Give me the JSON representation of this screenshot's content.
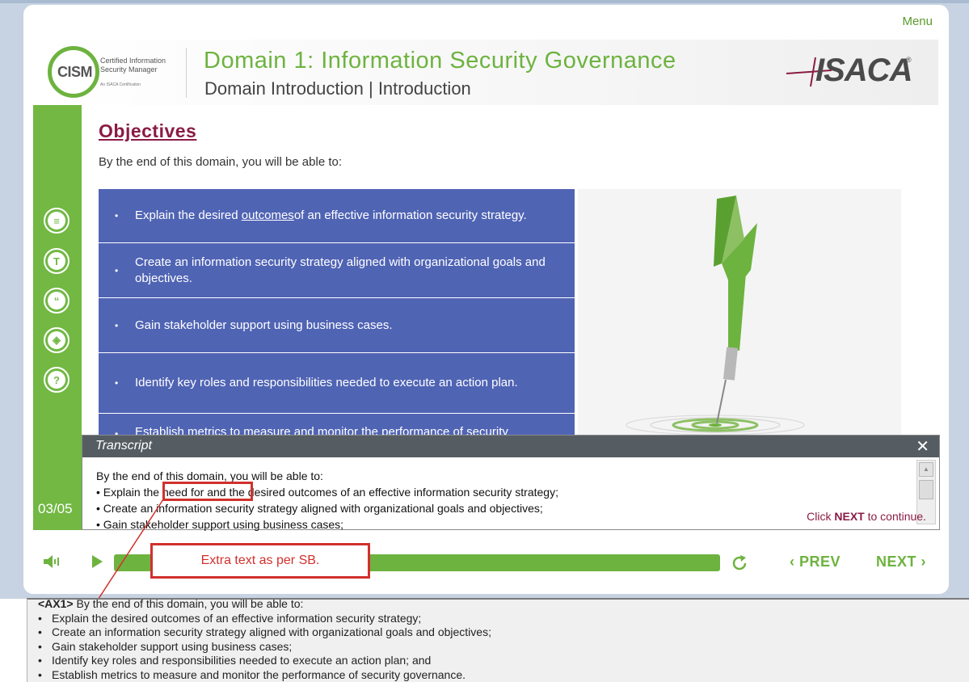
{
  "header": {
    "menu_label": "Menu",
    "cism_mark": "CISM",
    "cism_subtitle_line1": "Certified Information",
    "cism_subtitle_line2": "Security Manager",
    "cism_tagline": "An ISACA Certification",
    "domain_title": "Domain 1: Information Security Governance",
    "domain_subtitle": "Domain Introduction | Introduction",
    "isaca_logo": "ISACA",
    "isaca_reg": "®"
  },
  "sidebar": {
    "icons": [
      {
        "name": "notes-icon",
        "glyph": "≡"
      },
      {
        "name": "transcript-icon",
        "glyph": "T"
      },
      {
        "name": "quote-icon",
        "glyph": "“"
      },
      {
        "name": "layers-icon",
        "glyph": "◈"
      },
      {
        "name": "help-icon",
        "glyph": "?"
      }
    ],
    "page_counter": "03/05"
  },
  "content": {
    "heading": "Objectives",
    "intro": "By the end of this domain, you will be able to:",
    "objectives": [
      {
        "before": "Explain the desired ",
        "underlined": "outcomes",
        "after": " of an effective information security strategy."
      },
      {
        "before": "Create an information security strategy aligned with organizational goals and objectives.",
        "underlined": "",
        "after": ""
      },
      {
        "before": "Gain stakeholder support using business cases.",
        "underlined": "",
        "after": ""
      },
      {
        "before": "Identify key roles and responsibilities needed to execute an action plan.",
        "underlined": "",
        "after": ""
      },
      {
        "before": "Establish metrics to measure and monitor the performance of security",
        "underlined": "",
        "after": ""
      }
    ]
  },
  "transcript": {
    "title": "Transcript",
    "close_glyph": "✕",
    "lines": [
      "By the end of this domain, you will be able to:",
      "• Explain the need for and the desired outcomes of an effective information security strategy;",
      "• Create an information security strategy aligned with organizational goals and objectives;",
      "• Gain stakeholder support using business cases;"
    ],
    "click_prefix": "Click ",
    "click_next_word": "NEXT",
    "click_suffix": " to continue."
  },
  "controls": {
    "prev_label": "PREV",
    "next_label": "NEXT",
    "prev_glyph": "‹",
    "next_glyph": "›"
  },
  "annotation": {
    "callout_text": "Extra text as per SB."
  },
  "notes": {
    "tag": "<AX1>",
    "intro": " By the end of this domain, you will be able to:",
    "bullets": [
      "Explain the desired outcomes of an effective information security strategy;",
      "Create an information security strategy aligned with organizational goals and objectives;",
      "Gain stakeholder support using business cases;",
      "Identify key roles and responsibilities needed to execute an action plan; and",
      "Establish metrics to measure and monitor the performance of security governance."
    ]
  },
  "colors": {
    "green": "#6db33f",
    "objective_blue": "#5064b4",
    "heading_maroon": "#8a1c44",
    "annotation_red": "#d0312d",
    "transcript_header": "#555d63"
  }
}
